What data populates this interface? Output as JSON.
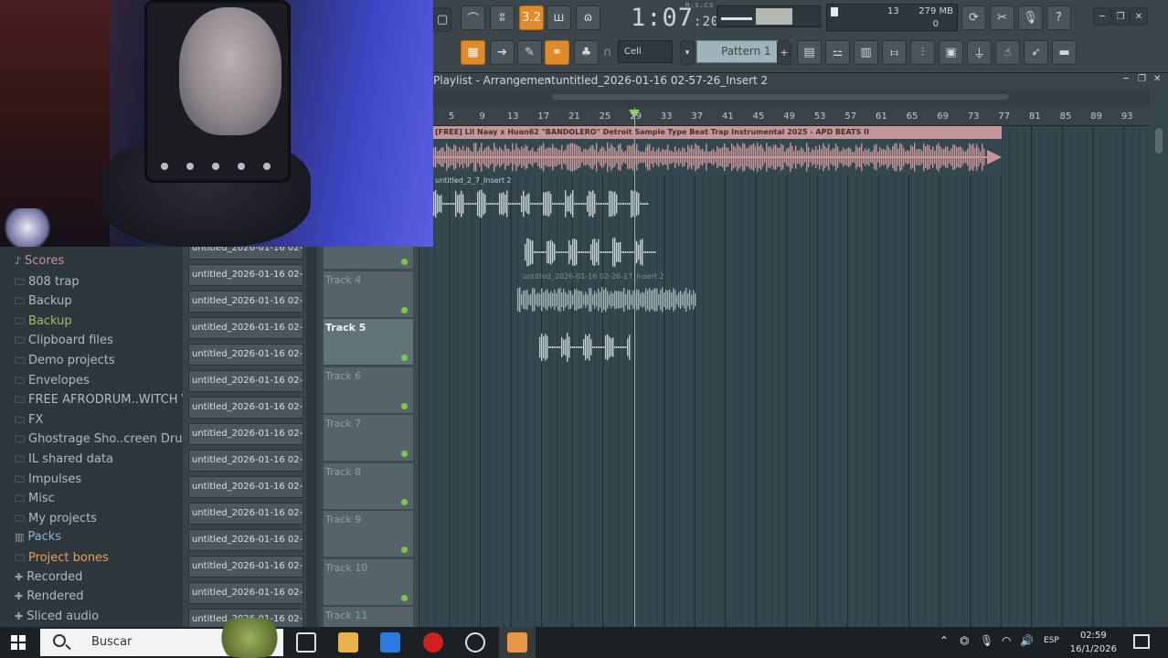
{
  "toolbar": {
    "time_main": "1:07",
    "time_sub": "20",
    "time_unit": "M:S:CS",
    "cpu_value": "13",
    "ram": "279 MB",
    "voices": "0",
    "snap": "Cell",
    "pattern": "Pattern 1",
    "top_left_label": "3.2"
  },
  "playlist": {
    "title": "Playlist - Arrangement",
    "project": "untitled_2026-01-16 02-57-26_Insert 2",
    "ticks": [
      "5",
      "9",
      "13",
      "17",
      "21",
      "25",
      "29",
      "33",
      "37",
      "41",
      "45",
      "49",
      "53",
      "57",
      "61",
      "65",
      "69",
      "73",
      "77",
      "81",
      "85",
      "89",
      "93"
    ],
    "clips": [
      {
        "label": "[FREE] Lil Naay x Huan62 \"BANDOLERO\" Detroit Sample Type Beat  Trap Instrumental 2025 - APD BEATS II"
      },
      {
        "label": "untitled_2_7_Insert 2"
      },
      {
        "label": "untitled_2026-01-16 02-26-17_Insert 2"
      }
    ]
  },
  "browser": {
    "items": [
      {
        "label": "Scores",
        "icon": "note-icon",
        "color": "pink"
      },
      {
        "label": "808 trap",
        "icon": "folder-icon",
        "color": "normal"
      },
      {
        "label": "Backup",
        "icon": "folder-icon",
        "color": "normal"
      },
      {
        "label": "Backup",
        "icon": "folder-icon",
        "color": "green"
      },
      {
        "label": "Clipboard files",
        "icon": "folder-icon",
        "color": "normal"
      },
      {
        "label": "Demo projects",
        "icon": "folder-icon",
        "color": "normal"
      },
      {
        "label": "Envelopes",
        "icon": "folder-icon",
        "color": "normal"
      },
      {
        "label": "FREE AFRODRUM..WITCH VIBEZ",
        "icon": "folder-icon",
        "color": "normal"
      },
      {
        "label": "FX",
        "icon": "folder-icon",
        "color": "normal"
      },
      {
        "label": "Ghostrage Sho..creen Drum Kit",
        "icon": "folder-icon",
        "color": "normal"
      },
      {
        "label": "IL shared data",
        "icon": "folder-icon",
        "color": "normal"
      },
      {
        "label": "Impulses",
        "icon": "folder-icon",
        "color": "normal"
      },
      {
        "label": "Misc",
        "icon": "folder-icon",
        "color": "normal"
      },
      {
        "label": "My projects",
        "icon": "folder-icon",
        "color": "normal"
      },
      {
        "label": "Packs",
        "icon": "packs-icon",
        "color": "blue"
      },
      {
        "label": "Project bones",
        "icon": "folder-icon",
        "color": "orange"
      },
      {
        "label": "Recorded",
        "icon": "plus-icon",
        "color": "normal"
      },
      {
        "label": "Rendered",
        "icon": "plus-icon",
        "color": "normal"
      },
      {
        "label": "Sliced audio",
        "icon": "plus-icon",
        "color": "normal"
      }
    ]
  },
  "picker": {
    "items": [
      "untitled_2026-01-16 02-...",
      "untitled_2026-01-16 02-...",
      "untitled_2026-01-16 02-...",
      "untitled_2026-01-16 02-...",
      "untitled_2026-01-16 02-...",
      "untitled_2026-01-16 02-...",
      "untitled_2026-01-16 02-...",
      "untitled_2026-01-16 02-...",
      "untitled_2026-01-16 02-...",
      "untitled_2026-01-16 02-...",
      "untitled_2026-01-16 02-...",
      "untitled_2026-01-16 02-...",
      "untitled_2026-01-16 02-...",
      "untitled_2026-01-16 02-...",
      "untitled_2026-01-16 02-..."
    ]
  },
  "tracks": [
    {
      "label": ""
    },
    {
      "label": "Track 4"
    },
    {
      "label": "Track 5"
    },
    {
      "label": "Track 6"
    },
    {
      "label": "Track 7"
    },
    {
      "label": "Track 8"
    },
    {
      "label": "Track 9"
    },
    {
      "label": "Track 10"
    },
    {
      "label": "Track 11"
    }
  ],
  "taskbar": {
    "search_placeholder": "Buscar",
    "lang": "ESP",
    "time": "02:59",
    "date": "16/1/2026"
  }
}
